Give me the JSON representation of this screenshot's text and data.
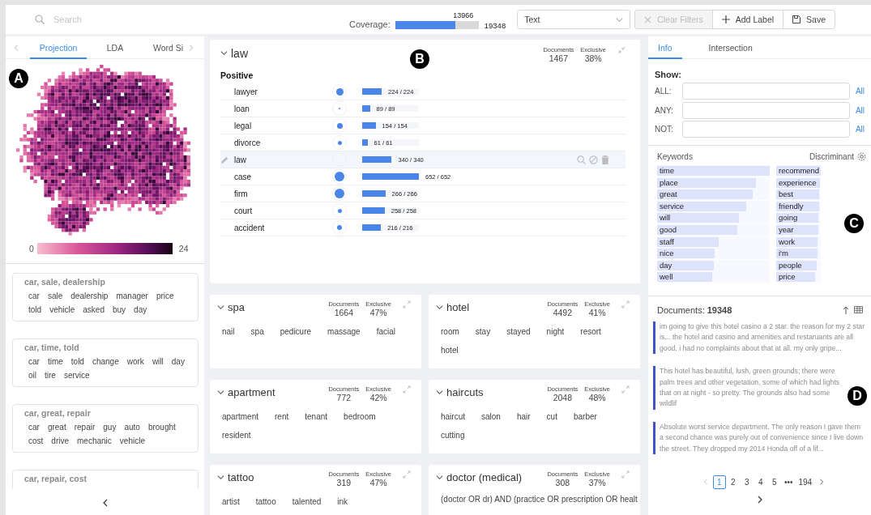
{
  "search": {
    "placeholder": "Search"
  },
  "coverage": {
    "label": "Coverage:",
    "value": "13966",
    "total": "19348",
    "level": 0.722
  },
  "view_select": {
    "value": "Text"
  },
  "toolbar": [
    {
      "label": "Clear Filters",
      "disabled": true
    },
    {
      "label": "Add Label",
      "disabled": false
    },
    {
      "label": "Save",
      "disabled": false
    }
  ],
  "left_panel": {
    "tabs": [
      {
        "label": "Projection",
        "selected": true
      },
      {
        "label": "LDA",
        "selected": false
      },
      {
        "label": "Word Si",
        "selected": false
      }
    ],
    "colorbar": {
      "min": "0",
      "max": "24"
    },
    "topics": [
      {
        "title": "car, sale, dealership",
        "words": [
          "car",
          "sale",
          "dealership",
          "manager",
          "price",
          "told",
          "vehicle",
          "asked",
          "buy",
          "day"
        ]
      },
      {
        "title": "car, time, told",
        "words": [
          "car",
          "time",
          "told",
          "change",
          "work",
          "will",
          "day",
          "oil",
          "tire",
          "service"
        ]
      },
      {
        "title": "car, great, repair",
        "words": [
          "car",
          "great",
          "repair",
          "guy",
          "auto",
          "brought",
          "cost",
          "drive",
          "mechanic",
          "vehicle"
        ]
      },
      {
        "title": "car, repair, cost"
      }
    ]
  },
  "active_label": {
    "title": "law",
    "documents_label": "Documents",
    "documents": "1467",
    "exclusive_label": "Exclusive",
    "exclusive": "38%",
    "section": "Positive",
    "terms": [
      {
        "word": "lawyer",
        "selected": false,
        "bar": {
          "level": 0.344
        },
        "count": "224 / 224"
      },
      {
        "word": "loan",
        "selected": false,
        "bar": {
          "level": 0.137
        },
        "count": "89 / 89"
      },
      {
        "word": "legal",
        "selected": false,
        "bar": {
          "level": 0.236
        },
        "count": "154 / 154"
      },
      {
        "word": "divorce",
        "selected": false,
        "bar": {
          "level": 0.094
        },
        "count": "61 / 61"
      },
      {
        "word": "law",
        "selected": true,
        "bar": {
          "level": 0.521
        },
        "count": "340 / 340"
      },
      {
        "word": "case",
        "selected": false,
        "bar": {
          "level": 1
        },
        "count": "652 / 652"
      },
      {
        "word": "firm",
        "selected": false,
        "bar": {
          "level": 0.408
        },
        "count": "266 / 266"
      },
      {
        "word": "court",
        "selected": false,
        "bar": {
          "level": 0.396
        },
        "count": "258 / 258"
      },
      {
        "word": "accident",
        "selected": false,
        "bar": {
          "level": 0.331
        },
        "count": "216 / 216"
      }
    ]
  },
  "labels": [
    {
      "title": "spa",
      "kind": "words",
      "documents_label": "Documents",
      "documents": "1664",
      "exclusive_label": "Exclusive",
      "exclusive": "47%",
      "words": [
        "nail",
        "spa",
        "pedicure",
        "massage",
        "facial"
      ]
    },
    {
      "title": "hotel",
      "kind": "words",
      "documents_label": "Documents",
      "documents": "4492",
      "exclusive_label": "Exclusive",
      "exclusive": "41%",
      "words": [
        "room",
        "stay",
        "stayed",
        "night",
        "resort",
        "hotel"
      ]
    },
    {
      "title": "apartment",
      "kind": "words",
      "documents_label": "Documents",
      "documents": "772",
      "exclusive_label": "Exclusive",
      "exclusive": "42%",
      "words": [
        "apartment",
        "rent",
        "tenant",
        "bedroom",
        "resident"
      ]
    },
    {
      "title": "haircuts",
      "kind": "words",
      "documents_label": "Documents",
      "documents": "2048",
      "exclusive_label": "Exclusive",
      "exclusive": "48%",
      "words": [
        "haircut",
        "salon",
        "hair",
        "cut",
        "barber",
        "cutting"
      ]
    },
    {
      "title": "tattoo",
      "kind": "words",
      "documents_label": "Documents",
      "documents": "319",
      "exclusive_label": "Exclusive",
      "exclusive": "47%",
      "words": [
        "artist",
        "tattoo",
        "talented",
        "ink"
      ]
    },
    {
      "title": "doctor (medical)",
      "kind": "query",
      "documents_label": "Documents",
      "documents": "308",
      "exclusive_label": "Exclusive",
      "exclusive": "37%",
      "query": "(doctor OR dr) AND (practice OR prescription OR healt"
    }
  ],
  "right_panel": {
    "tabs": [
      {
        "label": "Info",
        "selected": true
      },
      {
        "label": "Intersection",
        "selected": false
      }
    ],
    "show": {
      "title": "Show:",
      "filters": [
        {
          "label": "ALL:",
          "link": "All"
        },
        {
          "label": "ANY:",
          "link": "All"
        },
        {
          "label": "NOT:",
          "link": "All"
        }
      ]
    },
    "keywords": {
      "title": "Keywords",
      "mode": "Discriminant",
      "left": [
        {
          "word": "time",
          "level": 1
        },
        {
          "word": "place",
          "level": 0.88
        },
        {
          "word": "great",
          "level": 0.85
        },
        {
          "word": "service",
          "level": 0.79
        },
        {
          "word": "will",
          "level": 0.73
        },
        {
          "word": "good",
          "level": 0.71
        },
        {
          "word": "staff",
          "level": 0.55
        },
        {
          "word": "nice",
          "level": 0.51
        },
        {
          "word": "day",
          "level": 0.5
        },
        {
          "word": "well",
          "level": 0.49
        }
      ],
      "right": [
        {
          "word": "recommend",
          "level": 1
        },
        {
          "word": "experience",
          "level": 0.98
        },
        {
          "word": "best",
          "level": 0.96
        },
        {
          "word": "friendly",
          "level": 0.96
        },
        {
          "word": "going",
          "level": 0.94
        },
        {
          "word": "year",
          "level": 0.94
        },
        {
          "word": "work",
          "level": 0.92
        },
        {
          "word": "i'm",
          "level": 0.92
        },
        {
          "word": "people",
          "level": 0.9
        },
        {
          "word": "price",
          "level": 0.87
        }
      ]
    },
    "documents": {
      "header": "Documents: **19348**",
      "items": [
        "im going to give this hotel casino a 2 star. the reason for my 2 star is... the hotel and casino and amenities and restaruants are all good. i had no complaints about that at all. my only gripe...",
        "This hotel has beautiful, lush, green grounds; there were palm trees and other vegetation, some of which had lights that on at night - so pretty. The grounds also had some wildlif",
        "Absolute worst service department. The only reason I gave them a second chance was purely out of convenience since I live down the street. They dropped my 2014 Honda off of a lif..."
      ]
    },
    "pagination": [
      {
        "label": "1",
        "selected": true
      },
      {
        "label": "2",
        "selected": false
      },
      {
        "label": "3",
        "selected": false
      },
      {
        "label": "4",
        "selected": false
      },
      {
        "label": "5",
        "selected": false
      },
      {
        "label": "•••",
        "selected": false
      },
      {
        "label": "194",
        "selected": false
      }
    ]
  },
  "callouts": [
    {
      "label": "A"
    },
    {
      "label": "B"
    },
    {
      "label": "C"
    },
    {
      "label": "D"
    }
  ]
}
